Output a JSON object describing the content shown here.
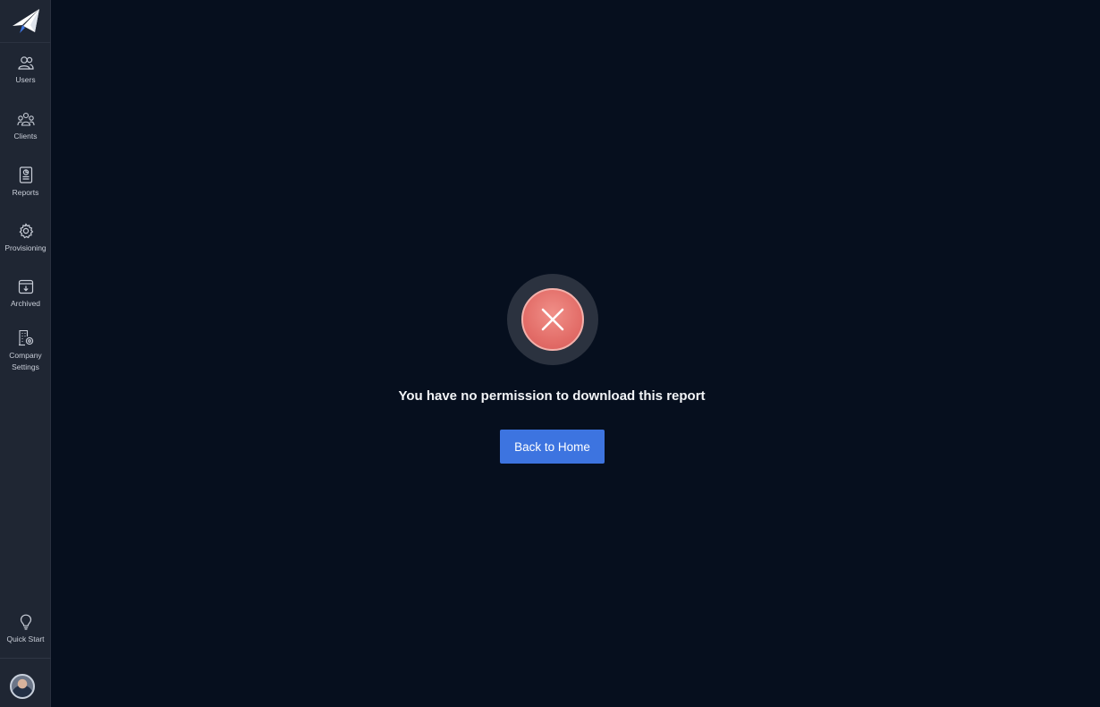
{
  "sidebar": {
    "logo_icon": "paper-plane-logo-icon",
    "items": [
      {
        "label": "Users",
        "icon": "users-icon"
      },
      {
        "label": "Clients",
        "icon": "clients-icon"
      },
      {
        "label": "Reports",
        "icon": "report-document-icon"
      },
      {
        "label": "Provisioning",
        "icon": "gear-icon"
      },
      {
        "label": "Archived",
        "icon": "archive-box-icon"
      },
      {
        "label": "Company\nSettings",
        "icon": "building-gear-icon"
      }
    ],
    "quick_start": {
      "label": "Quick Start",
      "icon": "lightbulb-icon"
    },
    "avatar_icon": "user-avatar"
  },
  "main": {
    "status_icon": "error-x-icon",
    "message": "You have no permission to download this report",
    "back_button_label": "Back to Home"
  },
  "colors": {
    "background": "#060f1e",
    "sidebar": "#1f2633",
    "error": "#e36e69",
    "primary_button": "#3d74e0"
  }
}
